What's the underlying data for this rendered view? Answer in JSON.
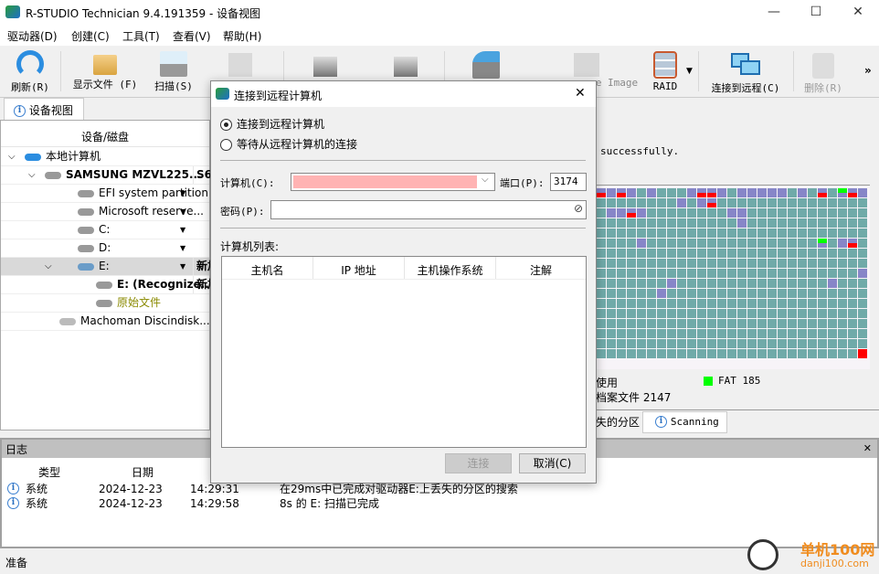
{
  "window": {
    "title": "R-STUDIO Technician 9.4.191359 - 设备视图",
    "minimize": "—",
    "maximize": "☐",
    "close": "✕"
  },
  "menu": [
    "驱动器(D)",
    "创建(C)",
    "工具(T)",
    "查看(V)",
    "帮助(H)"
  ],
  "toolbar": {
    "refresh": "刷新(R)",
    "show_files": "显示文件 (F)",
    "scan": "扫描(S)",
    "image_partial": "e Image",
    "raid": "RAID",
    "connect_remote": "连接到远程(C)",
    "delete": "删除(R)",
    "more": "»"
  },
  "tabs": {
    "device_view": "设备视图"
  },
  "tree": {
    "column": "设备/磁盘",
    "items": [
      {
        "label": "本地计算机",
        "col2": ""
      },
      {
        "label": "SAMSUNG MZVL225...",
        "col2": "S6"
      },
      {
        "label": "EFI system partition",
        "col2": ""
      },
      {
        "label": "Microsoft reserve...",
        "col2": ""
      },
      {
        "label": "C:",
        "col2": ""
      },
      {
        "label": "D:",
        "col2": ""
      },
      {
        "label": "E:",
        "col2": "新加"
      },
      {
        "label": "E: (Recognize...",
        "col2": "新加"
      },
      {
        "label": "原始文件",
        "col2": ""
      },
      {
        "label": "Machoman Discindisk...",
        "col2": ""
      }
    ]
  },
  "right": {
    "message_partial": "successfully.",
    "legend_used_partial": "使用",
    "legend_fat": "FAT 185",
    "legend_files_partial": "档案文件 2147",
    "tab_partitions_partial": "失的分区",
    "tab_scanning": "Scanning"
  },
  "disk_map": {
    "colors": {
      "T": "#70aaa9",
      "P": "#8786c8",
      "R": "#ff0000",
      "G": "#00ff00"
    },
    "rows": [
      "RPRPTPTTTPRRPTPPPPPTPTRTGRP",
      "TTTTTTTTPTPRTTTTTTTTTTTTTTT",
      "TPPRPTTTTTTTTPPTTTTTTTTTTTT",
      "TTTTTTTTTTTTTTPTTTTTTTTTTTT",
      "TTTTTTTTTTTTTTTTTTTTTTTTTTT",
      "TTTTPTTTTTTTTTTTTTTTTTGTPRT",
      "TTTTTTTTTTTTTTTTTTTTTTTTTTT",
      "TTTTTTTTTTTTTTTTTTTTTTTTTTT",
      "TTTTTTTTTTTTTTTTTTTTTTTTTTP",
      "TTTTTTTPTTTTTTTTTTTTTTTPTTT",
      "TTTTTTPTTTTTTTTTTTTTTTTTTTT",
      "TTTTTTTTTTTTTTTTTTTTTTTTTTT",
      "TTTTTTTTTTTTTTTTTTTTTTTTTTT",
      "TTTTTTTTTTTTTTTTTTTTTTTTTTT",
      "TTTTTTTTTTTTTTTTTTTTTTTTTTT",
      "TTTTTTTTTTTTTTTTTTTTTTTTTTT",
      "TTTTTTTTTTTTTTTTTTTTTTTTTTZ"
    ]
  },
  "log": {
    "title": "日志",
    "close": "✕",
    "columns": [
      "类型",
      "日期",
      ""
    ],
    "rows": [
      {
        "type": "系统",
        "date": "2024-12-23",
        "time": "14:29:31",
        "message": "在29ms中已完成对驱动器E:上丢失的分区的搜索"
      },
      {
        "type": "系统",
        "date": "2024-12-23",
        "time": "14:29:58",
        "message": "8s 的 E: 扫描已完成"
      }
    ]
  },
  "status": "准备",
  "dialog": {
    "title": "连接到远程计算机",
    "close": "✕",
    "radio_connect": "连接到远程计算机",
    "radio_wait": "等待从远程计算机的连接",
    "selected": "connect",
    "computer_label": "计算机(C):",
    "computer_value": "",
    "port_label": "端口(P):",
    "port_value": "3174",
    "password_label": "密码(P):",
    "password_value": "",
    "list_label": "计算机列表:",
    "columns": [
      "主机名",
      "IP 地址",
      "主机操作系统",
      "注解"
    ],
    "connect_button": "连接",
    "cancel_button": "取消(C)",
    "computer_field_color": "#ffb3b3"
  },
  "watermark": {
    "text": "单机100网",
    "url_text": "danji100.com"
  }
}
